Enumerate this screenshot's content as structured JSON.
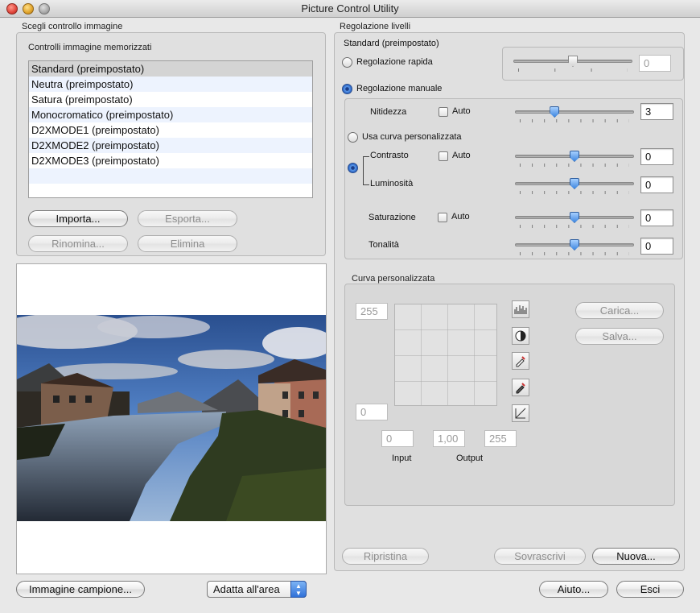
{
  "window": {
    "title": "Picture Control Utility"
  },
  "left": {
    "section_title": "Scegli controllo immagine",
    "stored_title": "Controlli immagine memorizzati",
    "items": [
      "Standard (preimpostato)",
      "Neutra (preimpostato)",
      "Satura (preimpostato)",
      "Monocromatico (preimpostato)",
      "D2XMODE1 (preimpostato)",
      "D2XMODE2 (preimpostato)",
      "D2XMODE3 (preimpostato)"
    ],
    "selected_index": 0,
    "buttons": {
      "import": "Importa...",
      "export": "Esporta...",
      "rename": "Rinomina...",
      "delete": "Elimina"
    }
  },
  "bottom": {
    "sample_image": "Immagine campione...",
    "fit_select": "Adatta all'area",
    "help": "Aiuto...",
    "exit": "Esci"
  },
  "right": {
    "section_title": "Regolazione livelli",
    "current_name": "Standard (preimpostato)",
    "quick_adjust": {
      "label": "Regolazione rapida",
      "value": "0",
      "level": 0.5
    },
    "manual_adjust": {
      "label": "Regolazione manuale"
    },
    "sharpness": {
      "label": "Nitidezza",
      "auto": "Auto",
      "value": "3",
      "level": 0.333
    },
    "custom_curve_option": "Usa curva personalizzata",
    "contrast": {
      "label": "Contrasto",
      "auto": "Auto",
      "value": "0",
      "level": 0.5
    },
    "brightness": {
      "label": "Luminosità",
      "value": "0",
      "level": 0.5
    },
    "saturation": {
      "label": "Saturazione",
      "auto": "Auto",
      "value": "0",
      "level": 0.5
    },
    "hue": {
      "label": "Tonalità",
      "value": "0",
      "level": 0.5
    },
    "curve": {
      "title": "Curva personalizzata",
      "out_max": "255",
      "out_min": "0",
      "in_left": "0",
      "gamma": "1,00",
      "in_right": "255",
      "input_label": "Input",
      "output_label": "Output",
      "load": "Carica...",
      "save": "Salva..."
    },
    "buttons": {
      "reset": "Ripristina",
      "overwrite": "Sovrascrivi",
      "new": "Nuova..."
    }
  },
  "colors": {
    "selection": "#d4d4d4",
    "alt_row": "#edf3fe",
    "accent": "#3f86df"
  }
}
